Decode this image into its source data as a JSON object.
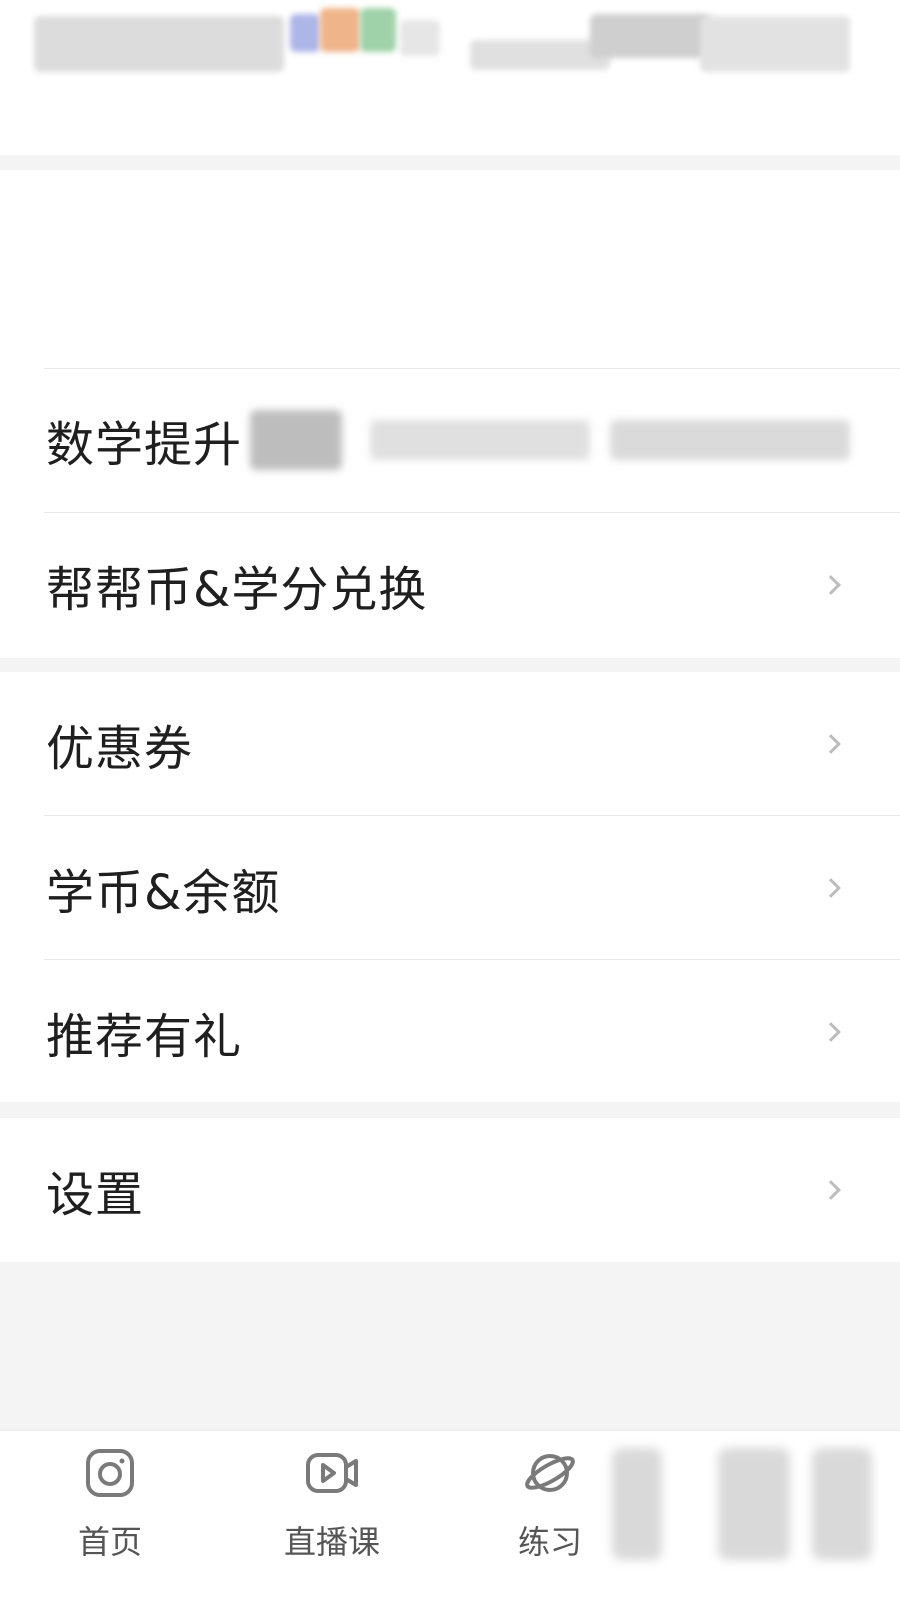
{
  "menu": {
    "math_label": "数学提升",
    "coin_exchange_label": "帮帮币&学分兑换",
    "coupon_label": "优惠券",
    "balance_label": "学币&余额",
    "recommend_label": "推荐有礼",
    "settings_label": "设置"
  },
  "tabbar": {
    "home_label": "首页",
    "live_label": "直播课",
    "practice_label": "练习"
  },
  "colors": {
    "chevron": "#bdbdbd",
    "text": "#1f1f1f",
    "tab_icon": "#7a7a7a"
  }
}
